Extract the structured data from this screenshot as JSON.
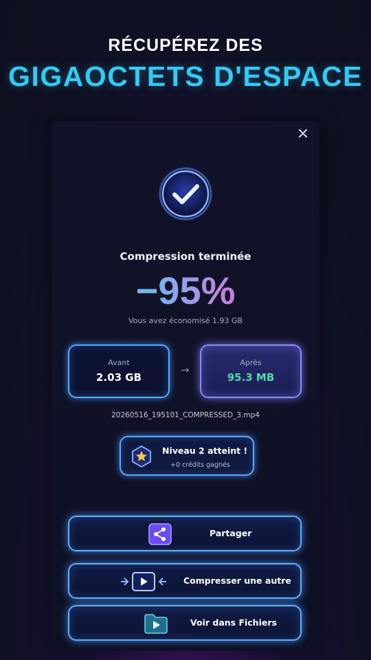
{
  "headline": {
    "line1": "RÉCUPÉREZ DES",
    "line2": "GIGAOCTETS D'ESPACE"
  },
  "dialog": {
    "close_glyph": "✕",
    "status": "Compression terminée",
    "percent": "−95%",
    "saved_text": "Vous avez économisé 1.93 GB",
    "before": {
      "caption": "Avant",
      "value": "2.03 GB"
    },
    "arrow": "→",
    "after": {
      "caption": "Après",
      "value": "95.3 MB"
    },
    "filename": "20260516_195101_COMPRESSED_3.mp4",
    "level": {
      "title": "Niveau 2 atteint !",
      "subtitle": "+0 crédits gagnés"
    },
    "buttons": {
      "share": "Partager",
      "compress_another": "Compresser une autre",
      "view_files": "Voir dans Fichiers"
    }
  },
  "colors": {
    "accent": "#35c9f2",
    "glow": "#5aa8ff",
    "after_value": "#4fdcaa"
  }
}
